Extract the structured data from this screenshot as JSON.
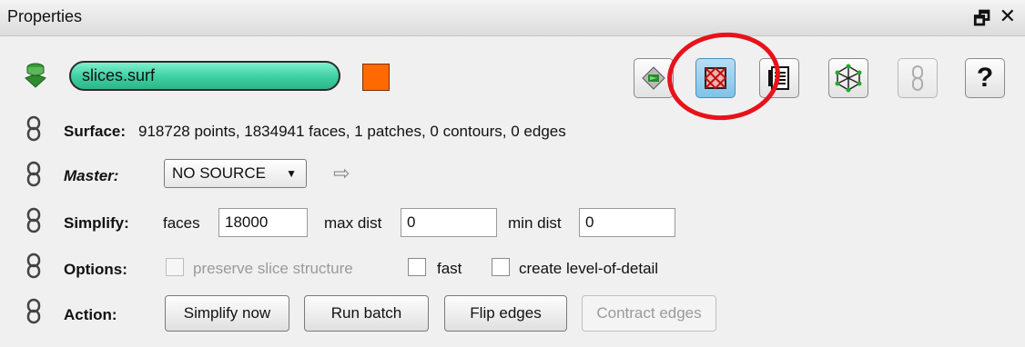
{
  "panel": {
    "title": "Properties",
    "float_icon": "float-window-icon",
    "close_icon": "close-icon"
  },
  "object": {
    "name": "slices.surf",
    "color": "#ff6a00",
    "icon": "surface-object-icon"
  },
  "toolbar": {
    "buttons": [
      {
        "icon": "surface-view-icon",
        "state": "normal"
      },
      {
        "icon": "mesh-simplify-icon",
        "state": "active",
        "highlighted": true
      },
      {
        "icon": "list-icon",
        "state": "normal"
      },
      {
        "icon": "network-icon",
        "state": "normal"
      },
      {
        "icon": "link-icon",
        "state": "disabled"
      },
      {
        "icon": "help-icon",
        "state": "normal",
        "glyph": "?"
      }
    ]
  },
  "rows": {
    "surface": {
      "label": "Surface:",
      "value": "918728 points, 1834941 faces, 1 patches, 0 contours, 0 edges"
    },
    "master": {
      "label": "Master:",
      "selected": "NO SOURCE"
    },
    "simplify": {
      "label": "Simplify:",
      "faces_label": "faces",
      "faces_value": "18000",
      "max_dist_label": "max dist",
      "max_dist_value": "0",
      "min_dist_label": "min dist",
      "min_dist_value": "0"
    },
    "options": {
      "label": "Options:",
      "preserve": "preserve slice structure",
      "fast": "fast",
      "lod": "create level-of-detail"
    },
    "action": {
      "label": "Action:",
      "simplify_now": "Simplify now",
      "run_batch": "Run batch",
      "flip_edges": "Flip edges",
      "contract_edges": "Contract edges"
    }
  }
}
